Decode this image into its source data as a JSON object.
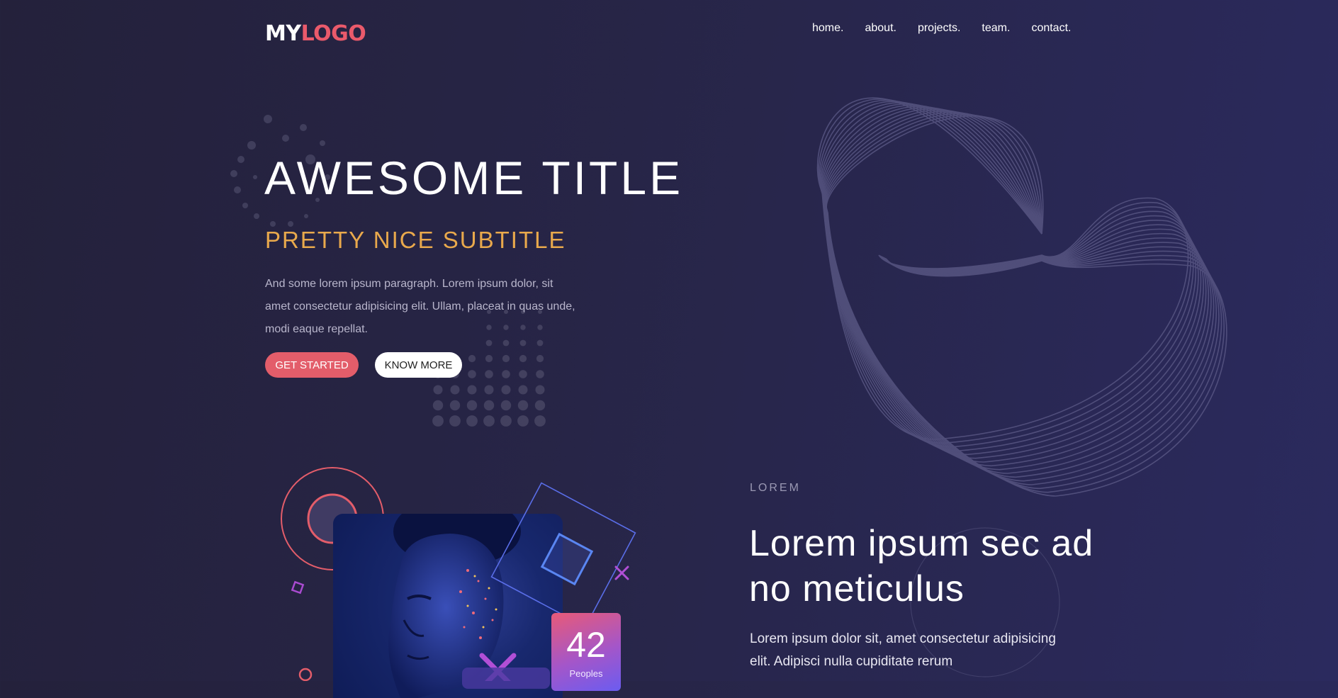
{
  "header": {
    "logo_part1": "MY",
    "logo_part2": "LOGO",
    "nav": [
      "home.",
      "about.",
      "projects.",
      "team.",
      "contact."
    ]
  },
  "hero": {
    "title": "AWESOME TITLE",
    "subtitle": "PRETTY NICE SUBTITLE",
    "paragraph": "And some lorem ipsum paragraph. Lorem ipsum dolor, sit amet consectetur adipisicing elit. Ullam, placeat in quas unde, modi eaque repellat.",
    "primary_button": "GET STARTED",
    "secondary_button": "KNOW MORE"
  },
  "feature": {
    "eyebrow": "LOREM",
    "heading": "Lorem ipsum sec ad no meticulus",
    "body": "Lorem ipsum dolor sit, amet consectetur adipisicing elit. Adipisci nulla cupiditate rerum",
    "stat_value": "42",
    "stat_label": "Peoples"
  },
  "colors": {
    "accent_red": "#ea5a6b",
    "accent_gold": "#e9a94c",
    "background": "#272547"
  }
}
